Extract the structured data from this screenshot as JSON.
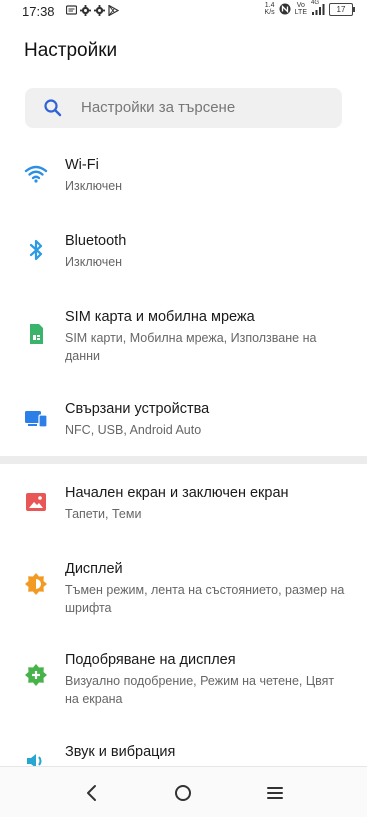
{
  "status": {
    "time": "17:38",
    "net_speed_value": "1.4",
    "net_speed_unit": "K/s",
    "volte_top": "Vo",
    "volte_bottom": "LTE",
    "network": "4G",
    "battery": "17"
  },
  "page": {
    "title": "Настройки"
  },
  "search": {
    "placeholder": "Настройки за търсене"
  },
  "items": [
    {
      "title": "Wi-Fi",
      "subtitle": "Изключен",
      "icon": "wifi-icon",
      "color": "#2b8fe6"
    },
    {
      "title": "Bluetooth",
      "subtitle": "Изключен",
      "icon": "bluetooth-icon",
      "color": "#2b9be6"
    },
    {
      "title": "SIM карта и мобилна мрежа",
      "subtitle": "SIM карти, Мобилна мрежа, Използване на данни",
      "icon": "sim-card-icon",
      "color": "#3ab46a"
    },
    {
      "title": "Свързани устройства",
      "subtitle": "NFC, USB, Android Auto",
      "icon": "devices-icon",
      "color": "#2b7fe6"
    },
    {
      "title": "Начален екран и заключен екран",
      "subtitle": "Тапети, Теми",
      "icon": "wallpaper-icon",
      "color": "#e95656"
    },
    {
      "title": "Дисплей",
      "subtitle": "Тъмен режим, лента на състоянието, размер на шрифта",
      "icon": "brightness-icon",
      "color": "#f29b24"
    },
    {
      "title": "Подобряване на дисплея",
      "subtitle": "Визуално подобрение, Режим на четене, Цвят на екрана",
      "icon": "display-enhance-icon",
      "color": "#48b34a"
    },
    {
      "title": "Звук и вибрация",
      "subtitle": "",
      "icon": "speaker-icon",
      "color": "#26a6d1"
    }
  ]
}
